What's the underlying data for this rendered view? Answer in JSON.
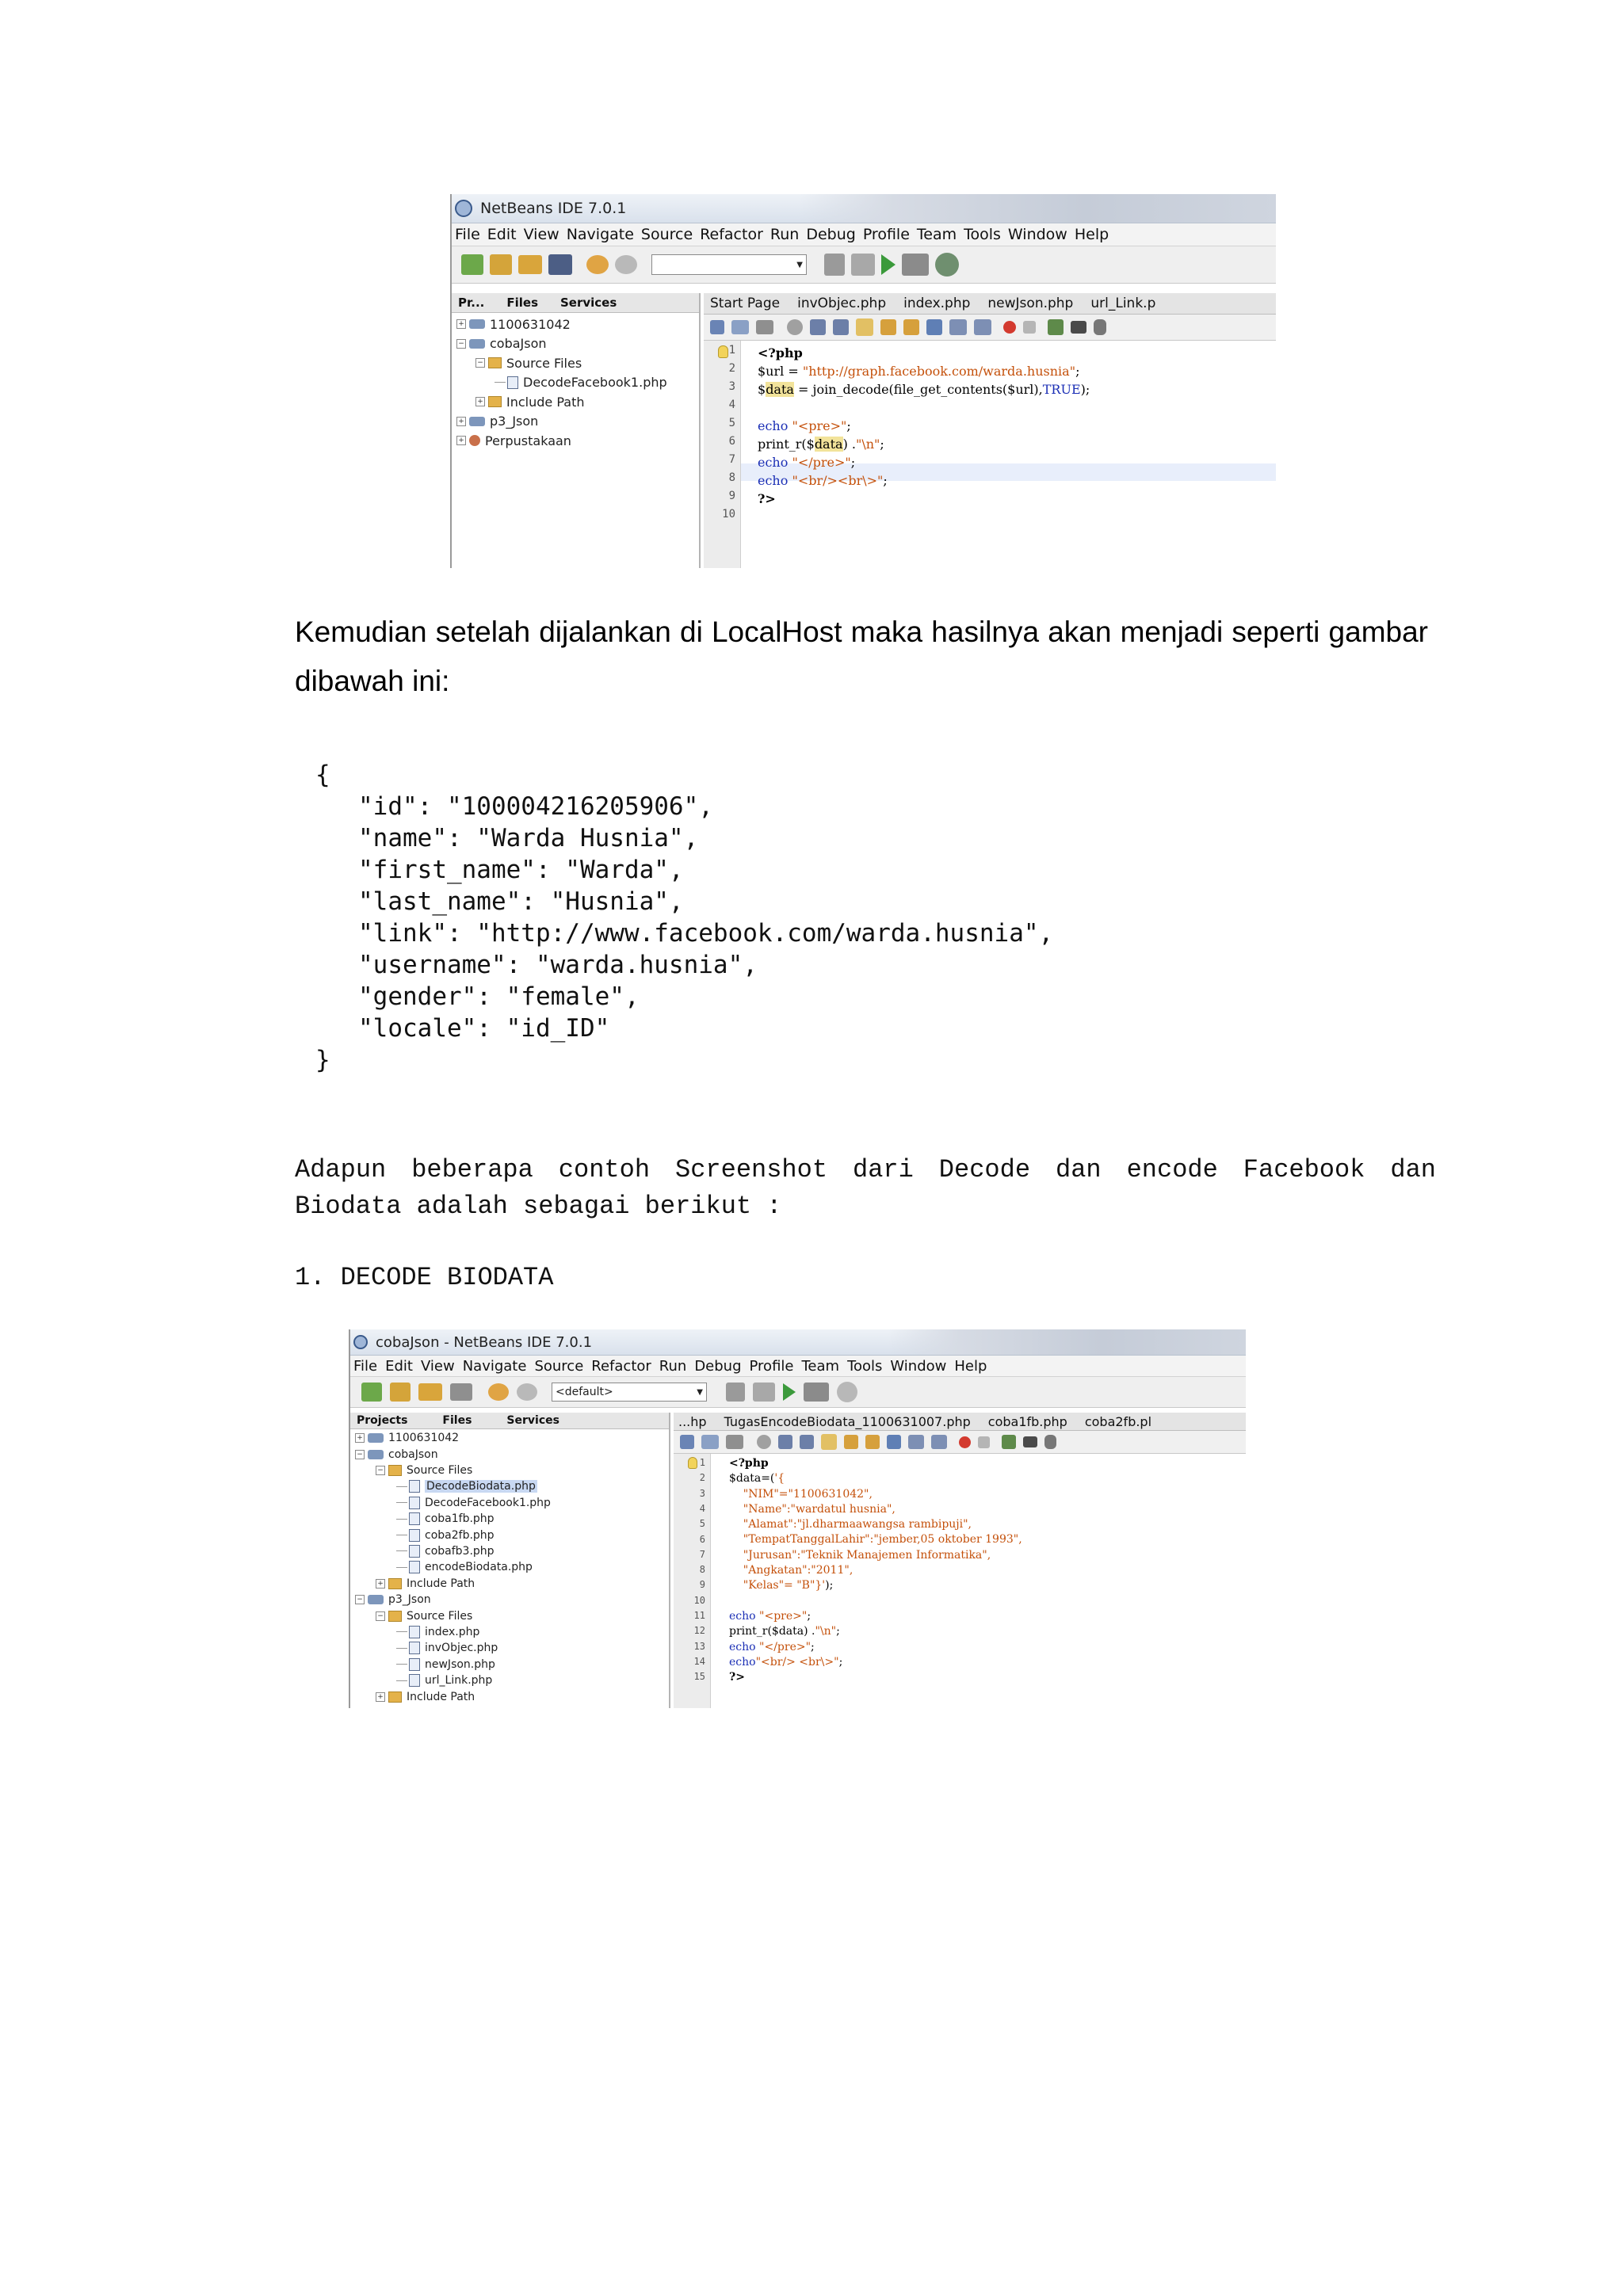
{
  "screenshot1": {
    "title": "NetBeans IDE 7.0.1",
    "menu": [
      "File",
      "Edit",
      "View",
      "Navigate",
      "Source",
      "Refactor",
      "Run",
      "Debug",
      "Profile",
      "Team",
      "Tools",
      "Window",
      "Help"
    ],
    "panel_tabs": [
      "Pr...",
      "Files",
      "Services"
    ],
    "tree": [
      {
        "label": "1100631042",
        "type": "project",
        "level": 0,
        "exp": "+"
      },
      {
        "label": "cobaJson",
        "type": "project",
        "level": 0,
        "exp": "-"
      },
      {
        "label": "Source Files",
        "type": "folder",
        "level": 1,
        "exp": "-"
      },
      {
        "label": "DecodeFacebook1.php",
        "type": "file",
        "level": 2,
        "exp": ""
      },
      {
        "label": "Include Path",
        "type": "folder",
        "level": 1,
        "exp": "+"
      },
      {
        "label": "p3_Json",
        "type": "project",
        "level": 0,
        "exp": "+"
      },
      {
        "label": "Perpustakaan",
        "type": "lib",
        "level": 0,
        "exp": "+"
      }
    ],
    "editor_tabs": [
      "Start Page",
      "invObjec.php",
      "index.php",
      "newJson.php",
      "url_Link.p"
    ],
    "line_numbers": [
      "1",
      "2",
      "3",
      "4",
      "5",
      "6",
      "7",
      "8",
      "9",
      "10"
    ]
  },
  "paragraph1": "Kemudian setelah dijalankan di LocalHost maka hasilnya akan menjadi seperti gambar dibawah ini:",
  "json_output": {
    "open": "{",
    "lines": [
      "\"id\": \"100004216205906\",",
      "\"name\": \"Warda Husnia\",",
      "\"first_name\": \"Warda\",",
      "\"last_name\": \"Husnia\",",
      "\"link\": \"http://www.facebook.com/warda.husnia\",",
      "\"username\": \"warda.husnia\",",
      "\"gender\": \"female\",",
      "\"locale\": \"id_ID\""
    ],
    "close": "}"
  },
  "paragraph2": "Adapun beberapa contoh Screenshot dari Decode dan encode Facebook dan Biodata adalah sebagai berikut :",
  "heading1": "1. DECODE BIODATA",
  "screenshot2": {
    "title": "cobaJson - NetBeans IDE 7.0.1",
    "menu": [
      "File",
      "Edit",
      "View",
      "Navigate",
      "Source",
      "Refactor",
      "Run",
      "Debug",
      "Profile",
      "Team",
      "Tools",
      "Window",
      "Help"
    ],
    "combo": "<default>",
    "panel_tabs": [
      "Projects",
      "Files",
      "Services"
    ],
    "tree": [
      {
        "label": "1100631042",
        "type": "project",
        "level": 0,
        "exp": "+"
      },
      {
        "label": "cobaJson",
        "type": "project",
        "level": 0,
        "exp": "-"
      },
      {
        "label": "Source Files",
        "type": "folder",
        "level": 1,
        "exp": "-"
      },
      {
        "label": "DecodeBiodata.php",
        "type": "file",
        "level": 2,
        "exp": "",
        "selected": true
      },
      {
        "label": "DecodeFacebook1.php",
        "type": "file",
        "level": 2,
        "exp": ""
      },
      {
        "label": "coba1fb.php",
        "type": "file",
        "level": 2,
        "exp": ""
      },
      {
        "label": "coba2fb.php",
        "type": "file",
        "level": 2,
        "exp": ""
      },
      {
        "label": "cobafb3.php",
        "type": "file",
        "level": 2,
        "exp": ""
      },
      {
        "label": "encodeBiodata.php",
        "type": "file",
        "level": 2,
        "exp": ""
      },
      {
        "label": "Include Path",
        "type": "folder",
        "level": 1,
        "exp": "+"
      },
      {
        "label": "p3_Json",
        "type": "project",
        "level": 0,
        "exp": "-"
      },
      {
        "label": "Source Files",
        "type": "folder",
        "level": 1,
        "exp": "-"
      },
      {
        "label": "index.php",
        "type": "file",
        "level": 2,
        "exp": ""
      },
      {
        "label": "invObjec.php",
        "type": "file",
        "level": 2,
        "exp": ""
      },
      {
        "label": "newJson.php",
        "type": "file",
        "level": 2,
        "exp": ""
      },
      {
        "label": "url_Link.php",
        "type": "file",
        "level": 2,
        "exp": ""
      },
      {
        "label": "Include Path",
        "type": "folder",
        "level": 1,
        "exp": "+"
      }
    ],
    "editor_tabs": [
      "...hp",
      "TugasEncodeBiodata_1100631007.php",
      "coba1fb.php",
      "coba2fb.pl"
    ],
    "line_numbers": [
      "1",
      "2",
      "3",
      "4",
      "5",
      "6",
      "7",
      "8",
      "9",
      "10",
      "11",
      "12",
      "13",
      "14",
      "15"
    ]
  }
}
